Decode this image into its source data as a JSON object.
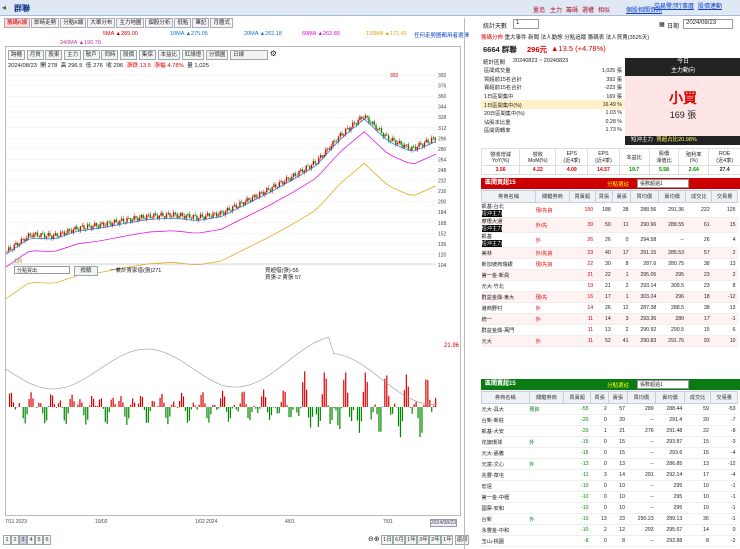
{
  "window": {
    "title": "群聯"
  },
  "header_links": [
    "量追",
    "主力",
    "籌碼",
    "選權",
    "相似"
  ],
  "header_right": [
    "個股相關資訊",
    "交易警示",
    "行事曆",
    "股價連動"
  ],
  "tabs": [
    "籌碼K線",
    "即時走勢",
    "分點K線",
    "大單分布",
    "主力地圖",
    "個股分析",
    "低點",
    "筆記",
    "月曆式"
  ],
  "ma": [
    {
      "label": "5MA",
      "value": "▲289.00",
      "color": "#d60000"
    },
    {
      "label": "10MA",
      "value": "▲275.05",
      "color": "#0a78d2"
    },
    {
      "label": "20MA",
      "value": "▲262.18",
      "color": "#1c6bd6"
    },
    {
      "label": "60MA",
      "value": "▲262.85",
      "color": "#e000e0"
    },
    {
      "label": "120MA",
      "value": "▲171.41",
      "color": "#e5a000"
    },
    {
      "label": "240MA",
      "value": "▲190.78",
      "color": "#c03aa8"
    }
  ],
  "ma_right": "任何走勢圖都用者選擇",
  "chart_toolbar": [
    "跨櫃",
    "月質",
    "股東",
    "主力",
    "散戶",
    "同時",
    "股價",
    "集保",
    "本益比",
    "紅綠燈",
    "分價圖",
    "日線"
  ],
  "quote_line": {
    "date": "2024/08/23",
    "open": "開 278",
    "high": "高 296.5",
    "low": "低 276",
    "close": "收 296",
    "change": "漲跌 13.5",
    "pct": "漲幅 4.78%",
    "vol": "量 1,025"
  },
  "price_axis": [
    "392",
    "376",
    "360",
    "344",
    "328",
    "312",
    "296",
    "280",
    "264",
    "248",
    "232",
    "216",
    "200",
    "184",
    "168",
    "152",
    "136",
    "120",
    "104"
  ],
  "indicator": {
    "select": "分點買出",
    "btn": "檢驗",
    "legend": "一兼計賣家借(張)271",
    "legend2": "買超借(張)-55",
    "legend3": "買張-2 賣張 57",
    "current_value": "21.96"
  },
  "x_axis": [
    "7/11\n2023",
    "10/02",
    "1/02\n2024",
    "4/01",
    "7/01",
    "2024/08/23"
  ],
  "bottom_bar": {
    "pages": [
      "1",
      "2",
      "3",
      "4",
      "5",
      "6"
    ],
    "ranges": [
      "1日",
      "6月",
      "1年",
      "3年",
      "2年",
      "1年"
    ],
    "end": "還原"
  },
  "rp": {
    "count_label": "統計天數",
    "count_val": "1",
    "date_label": "日期",
    "date_val": "2024/08/23",
    "tabs": [
      "籌碼分佈",
      "重大事件",
      "新聞",
      "法人動態",
      "分點追蹤",
      "籌碼表",
      "法人買賣(3525天)"
    ],
    "stock": "6664 群聯",
    "price": "296元",
    "chg": "▲13.5 (+4.78%)",
    "period_label": "統計區間",
    "period": "20240823 ~ 20240823",
    "sum": [
      [
        "區間成交量",
        "1,025 張"
      ],
      [
        "買超前15名合計",
        "392 張"
      ],
      [
        "賣超前15名合計",
        "-223 張"
      ],
      [
        "1日區間集中",
        "169 張"
      ],
      [
        "1日區間集中(%)",
        "16.49 %"
      ],
      [
        "20日區間集中(%)",
        "1.03 %"
      ],
      [
        "佔股本比重",
        "0.28 %"
      ],
      [
        "區間周轉率",
        "1.73 %"
      ]
    ],
    "today": "今日",
    "force": "主力動向",
    "verdict": "小買",
    "verdict_num": "169 張",
    "short": "短沖主力",
    "short_pct": "買超占比20.98%",
    "ind_head": [
      "營收增減\nYoY(%)",
      "營收\nMoM(%)",
      "EPS\n(近4季)",
      "EPS\n(近4季)",
      "本益比",
      "股價\n淨值比",
      "殖利率\n(%)",
      "ROE\n(近4季)"
    ],
    "ind_vals": [
      "3.56",
      "4.22",
      "4.09",
      "14.57",
      "19.7",
      "5.58",
      "2.64",
      "27.4"
    ],
    "buy_title": "區間買超15",
    "sell_title": "區間賣超15",
    "filter": "分點選註",
    "filter_val": "張數超過1",
    "cols": [
      "券商名稱",
      "關鍵券商",
      "買賣超",
      "買張",
      "賣張",
      "買均價",
      "賣均價",
      "成交比",
      "交易量"
    ],
    "buy_rows": [
      [
        "凱基-台北\n短沖主力",
        "現/先資",
        "150",
        "188",
        "38",
        "288.56",
        "291.36",
        "222",
        "125"
      ],
      [
        "摩根大通\n短沖主力",
        "外/先",
        "39",
        "50",
        "11",
        "290.96",
        "288.55",
        "61",
        "15"
      ],
      [
        "凱基\n短沖主力",
        "外",
        "26",
        "26",
        "0",
        "294.58",
        "--",
        "26",
        "4"
      ],
      [
        "美林",
        "外/先資",
        "23",
        "40",
        "17",
        "291.15",
        "285.53",
        "57",
        "2"
      ],
      [
        "新加坡商瑞銀",
        "現/先資",
        "22",
        "30",
        "8",
        "287.6",
        "280.75",
        "38",
        "13"
      ],
      [
        "第一金-新員",
        "",
        "21",
        "22",
        "1",
        "295.05",
        "295",
        "23",
        "2"
      ],
      [
        "元大-竹北",
        "",
        "19",
        "21",
        "2",
        "293.14",
        "309.5",
        "23",
        "8"
      ],
      [
        "群益金鼎-東大",
        "現/先",
        "16",
        "17",
        "1",
        "303.24",
        "296",
        "18",
        "-12"
      ],
      [
        "港商野村",
        "外",
        "14",
        "26",
        "12",
        "287.38",
        "288.5",
        "38",
        "13"
      ],
      [
        "統一",
        "外",
        "11",
        "14",
        "3",
        "293.36",
        "280",
        "17",
        "-1"
      ],
      [
        "群益金鼎-萬門",
        "",
        "11",
        "13",
        "2",
        "290.92",
        "290.5",
        "15",
        "6"
      ],
      [
        "元大",
        "外",
        "11",
        "52",
        "41",
        "290.83",
        "291.76",
        "93",
        "10"
      ]
    ],
    "sell_rows": [
      [
        "元大-具大",
        "現資",
        "-55",
        "2",
        "57",
        "289",
        "288.44",
        "59",
        "-53"
      ],
      [
        "台新-新莊",
        "",
        "-20",
        "0",
        "20",
        "--",
        "291.4",
        "20",
        "-7"
      ],
      [
        "凱基-大安",
        "",
        "-20",
        "1",
        "21",
        "276",
        "291.48",
        "22",
        "-8"
      ],
      [
        "花旗環球",
        "外",
        "-15",
        "0",
        "15",
        "--",
        "293.87",
        "15",
        "-3"
      ],
      [
        "元大-嘉義",
        "",
        "-15",
        "0",
        "15",
        "--",
        "293.6",
        "15",
        "-4"
      ],
      [
        "元富-文心",
        "外",
        "-13",
        "0",
        "13",
        "--",
        "286.85",
        "13",
        "-12"
      ],
      [
        "兆豐-草屯",
        "",
        "-11",
        "3",
        "14",
        "291",
        "292.14",
        "17",
        "-4"
      ],
      [
        "宏遠",
        "",
        "-10",
        "0",
        "10",
        "--",
        "295",
        "10",
        "-1"
      ],
      [
        "第一金-中壢",
        "",
        "-10",
        "0",
        "10",
        "--",
        "295",
        "10",
        "-1"
      ],
      [
        "國票-安和",
        "",
        "-10",
        "0",
        "10",
        "--",
        "295",
        "10",
        "-1"
      ],
      [
        "台新",
        "外",
        "-10",
        "13",
        "23",
        "290.23",
        "289.13",
        "36",
        "-1"
      ],
      [
        "永豐金-中和",
        "",
        "-10",
        "2",
        "12",
        "293",
        "295.67",
        "14",
        "0"
      ],
      [
        "玉山-桃園",
        "",
        "-8",
        "0",
        "8",
        "--",
        "293.88",
        "8",
        "-2"
      ]
    ]
  },
  "chart_data": {
    "type": "candlestick",
    "title": "",
    "xlabel": "",
    "ylabel": "",
    "ylim": [
      104,
      392
    ],
    "x": [
      "7/11",
      "10/02",
      "1/02",
      "4/01",
      "7/01",
      "2024/08/23"
    ],
    "annotations": [
      "120",
      "392"
    ],
    "close_approx": [
      125,
      150,
      148,
      160,
      165,
      172,
      178,
      180,
      176,
      182,
      200,
      218,
      238,
      260,
      300,
      330,
      296,
      280,
      296
    ]
  }
}
